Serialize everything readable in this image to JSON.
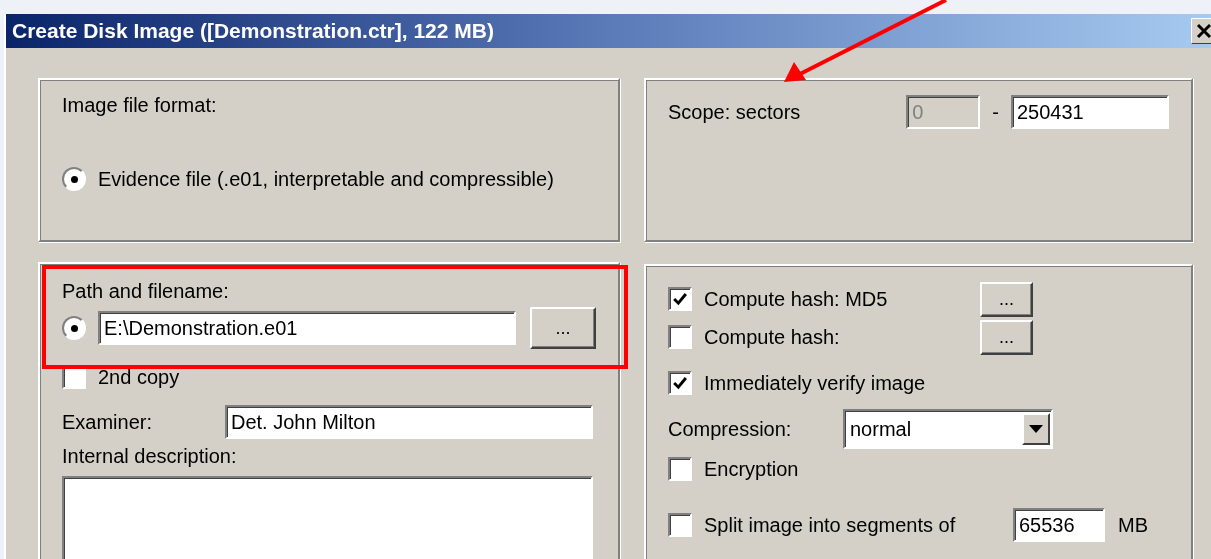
{
  "window": {
    "title": "Create Disk Image ([Demonstration.ctr], 122 MB)"
  },
  "format": {
    "label": "Image file format:",
    "options": [
      {
        "label": "Evidence file (.e01, interpretable and compressible)",
        "selected": true
      }
    ]
  },
  "scope": {
    "label": "Scope: sectors",
    "from": "0",
    "from_disabled": true,
    "separator": "-",
    "to": "250431"
  },
  "output": {
    "label": "Path and filename:",
    "path_selected": true,
    "path": "E:\\Demonstration.e01",
    "browse": "...",
    "second_copy": {
      "label": "2nd copy",
      "checked": false
    },
    "examiner_label": "Examiner:",
    "examiner": "Det. John Milton",
    "description_label": "Internal description:"
  },
  "options": {
    "hashes": [
      {
        "label": "Compute hash: MD5",
        "checked": true,
        "button": "..."
      },
      {
        "label": "Compute hash:",
        "checked": false,
        "button": "..."
      }
    ],
    "verify": {
      "label": "Immediately verify image",
      "checked": true
    },
    "compression_label": "Compression:",
    "compression": "normal",
    "encryption": {
      "label": "Encryption",
      "checked": false
    },
    "split": {
      "label": "Split image into segments of",
      "checked": false,
      "value": "65536",
      "unit": "MB"
    }
  }
}
